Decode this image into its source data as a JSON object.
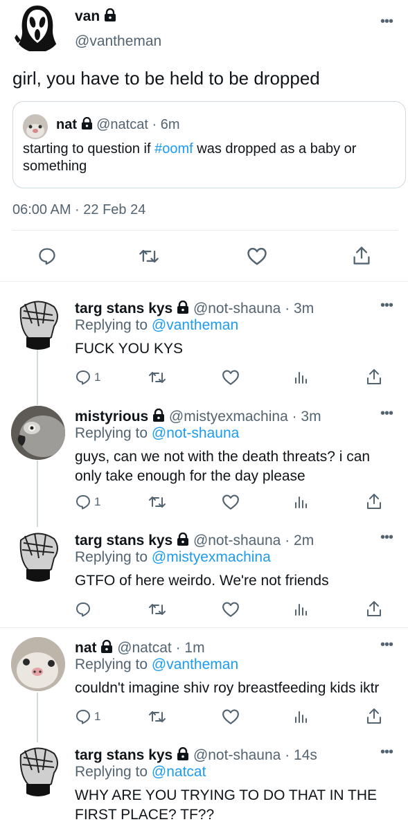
{
  "main_tweet": {
    "display_name": "van",
    "handle": "@vantheman",
    "text": "girl, you have to be held to be dropped",
    "timestamp": "06:00 AM · 22 Feb 24",
    "quote": {
      "display_name": "nat",
      "handle": "@natcat",
      "time": "· 6m",
      "text_before": "starting to question if ",
      "hashtag": "#oomf",
      "text_after": " was dropped as a baby or something"
    }
  },
  "replies": [
    {
      "display_name": "targ stans kys",
      "handle": "@not-shauna",
      "time": "· 3m",
      "replying_label": "Replying to",
      "replying_to": "@vantheman",
      "text": "FUCK YOU KYS",
      "reply_count": "1"
    },
    {
      "display_name": "mistyrious",
      "handle": "@mistyexmachina",
      "time": "· 3m",
      "replying_label": "Replying to",
      "replying_to": "@not-shauna",
      "text": "guys, can we not with the death threats? i can only take enough for the day please",
      "reply_count": "1"
    },
    {
      "display_name": "targ stans kys",
      "handle": "@not-shauna",
      "time": "· 2m",
      "replying_label": "Replying to",
      "replying_to": "@mistyexmachina",
      "text": "GTFO of here weirdo. We're not friends",
      "reply_count": ""
    },
    {
      "display_name": "nat",
      "handle": "@natcat",
      "time": "· 1m",
      "replying_label": "Replying to",
      "replying_to": "@vantheman",
      "text": "couldn't imagine shiv roy breastfeeding kids iktr",
      "reply_count": "1"
    },
    {
      "display_name": "targ stans kys",
      "handle": "@not-shauna",
      "time": "· 14s",
      "replying_label": "Replying to",
      "replying_to": "@natcat",
      "text": "WHY ARE YOU TRYING TO DO THAT IN THE FIRST PLACE? TF??",
      "reply_count": ""
    }
  ],
  "colors": {
    "link": "#1d9bf0",
    "muted": "#536471",
    "divider": "#e6ecf0"
  }
}
